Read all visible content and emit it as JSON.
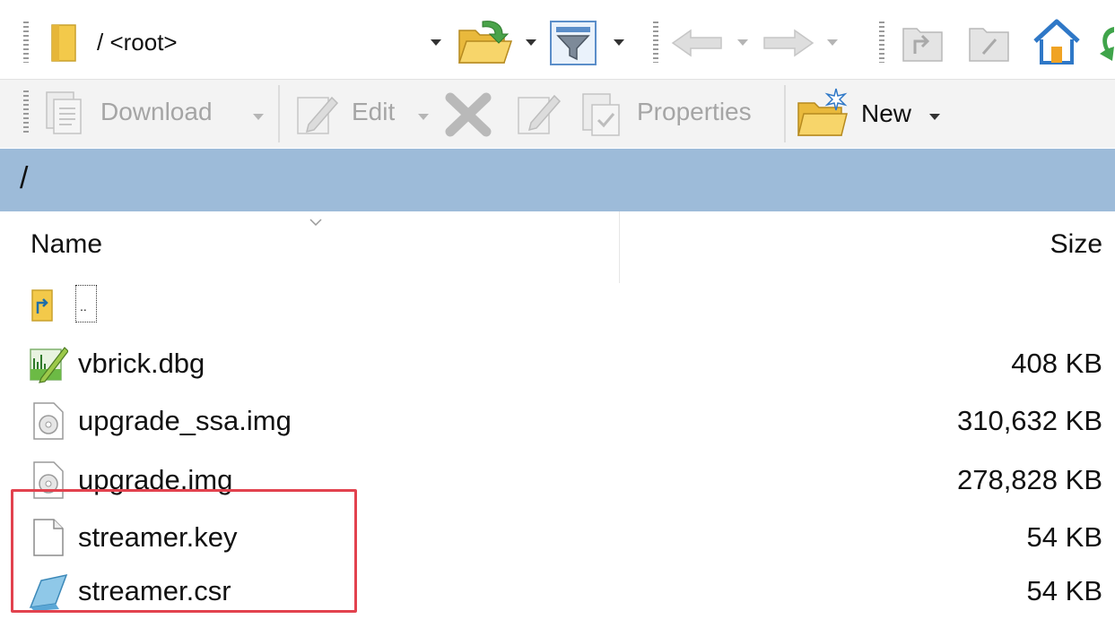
{
  "toolbar_top": {
    "path_value": "/ <root>",
    "icons": [
      "folder-icon",
      "open-folder-icon",
      "filter-icon",
      "back-arrow-icon",
      "forward-arrow-icon",
      "parent-directory-icon",
      "root-directory-icon",
      "home-icon"
    ]
  },
  "toolbar_actions": {
    "download_label": "Download",
    "edit_label": "Edit",
    "properties_label": "Properties",
    "new_label": "New"
  },
  "path_bar": {
    "path": "/"
  },
  "file_list": {
    "columns": {
      "name": "Name",
      "size": "Size"
    },
    "rows": [
      {
        "name": "..",
        "size": "",
        "icon": "parent-folder-icon"
      },
      {
        "name": "vbrick.dbg",
        "size": "408 KB",
        "icon": "chart-file-icon"
      },
      {
        "name": "upgrade_ssa.img",
        "size": "310,632 KB",
        "icon": "disc-image-icon"
      },
      {
        "name": "upgrade.img",
        "size": "278,828 KB",
        "icon": "disc-image-icon"
      },
      {
        "name": "streamer.key",
        "size": "54 KB",
        "icon": "blank-file-icon"
      },
      {
        "name": "streamer.csr",
        "size": "54 KB",
        "icon": "certificate-file-icon"
      }
    ]
  },
  "colors": {
    "path_bar_bg": "#9dbbd9",
    "highlight_border": "#e2424e",
    "folder_yellow": "#f3c94a"
  }
}
